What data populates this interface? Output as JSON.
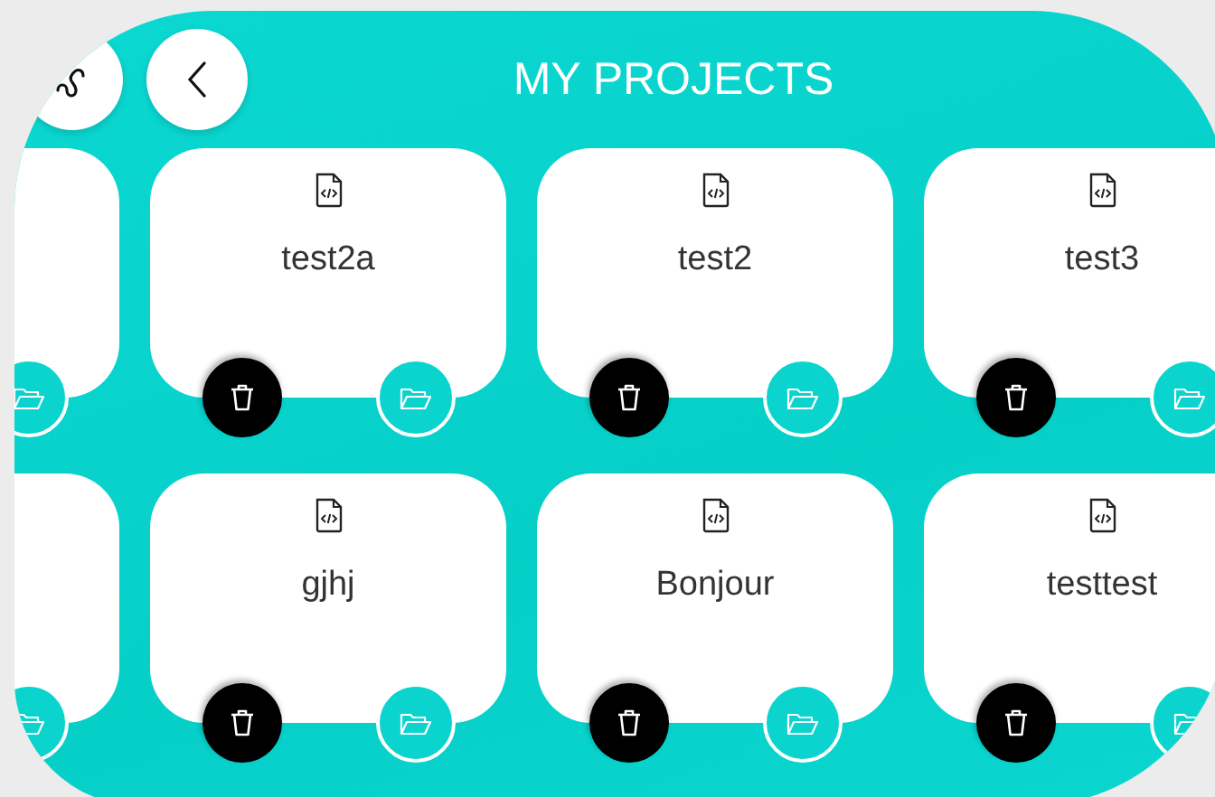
{
  "header": {
    "title": "MY PROJECTS"
  },
  "projects": [
    {
      "kind": "clipped"
    },
    {
      "kind": "project",
      "name": "test2a"
    },
    {
      "kind": "project",
      "name": "test2"
    },
    {
      "kind": "project",
      "name": "test3"
    },
    {
      "kind": "clipped"
    },
    {
      "kind": "project",
      "name": "gjhj"
    },
    {
      "kind": "project",
      "name": "Bonjour"
    },
    {
      "kind": "project",
      "name": "testtest"
    }
  ]
}
